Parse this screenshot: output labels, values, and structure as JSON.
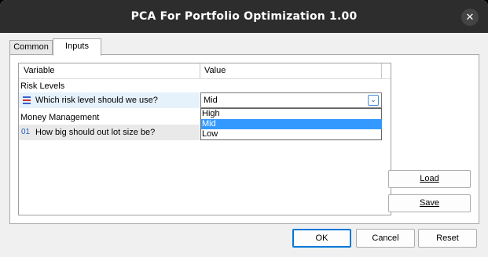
{
  "window": {
    "title": "PCA For Portfolio Optimization 1.00"
  },
  "tabs": [
    {
      "label": "Common"
    },
    {
      "label": "Inputs"
    }
  ],
  "grid": {
    "columns": [
      "Variable",
      "Value"
    ],
    "rows": [
      {
        "type": "group",
        "label": "Risk Levels"
      },
      {
        "type": "param",
        "icon": "enum-list-icon",
        "label": "Which risk level should we use?",
        "value": "Mid"
      },
      {
        "type": "group",
        "label": "Money Management"
      },
      {
        "type": "param",
        "icon": "numeric-icon",
        "icon_text": "01",
        "label": "How big should out lot size be?",
        "value": ""
      }
    ]
  },
  "dropdown": {
    "options": [
      "High",
      "Mid",
      "Low"
    ],
    "selected": "Mid"
  },
  "side_buttons": {
    "load": "Load",
    "save": "Save"
  },
  "footer": {
    "ok": "OK",
    "cancel": "Cancel",
    "reset": "Reset"
  },
  "colors": {
    "accent": "#0078d7",
    "selection": "#3399ff",
    "titlebar": "#2d2d2d"
  }
}
